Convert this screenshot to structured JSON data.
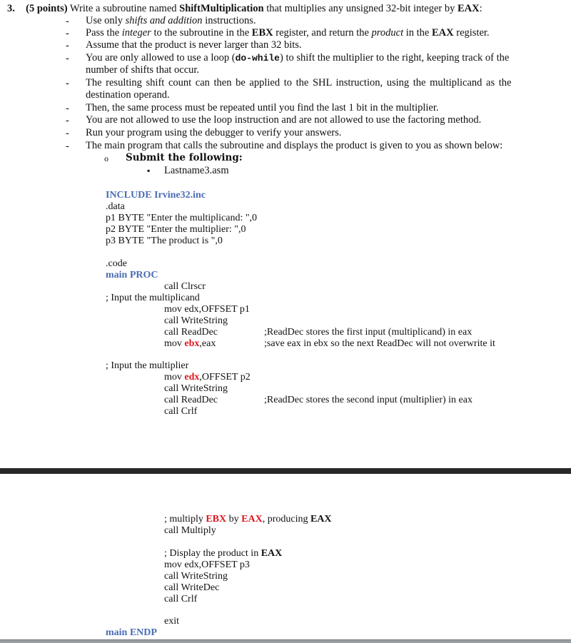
{
  "question": {
    "number": "3.",
    "points": "(5 points)",
    "intro_pre": " Write a subroutine named ",
    "subroutine_name": "ShiftMultiplication",
    "intro_post": " that multiplies any unsigned 32-bit integer by ",
    "intro_reg": "EAX",
    "intro_end": ":"
  },
  "bullets": [
    {
      "parts": [
        "Use only ",
        "shifts and addition",
        " instructions."
      ]
    },
    {
      "parts": [
        "Pass the ",
        "integer",
        " to the subroutine in the ",
        "EBX",
        " register, and return the ",
        "product",
        " in the ",
        "EAX",
        " register."
      ]
    },
    {
      "parts": [
        "Assume that the product is never larger than 32 bits."
      ]
    },
    {
      "parts": [
        "You are only allowed to use a loop (",
        "do-while",
        ") to shift the multiplier to the right, keeping track of the",
        "number of shifts that occur."
      ]
    },
    {
      "parts": [
        "The resulting shift count can then be applied to the SHL instruction, using the multiplicand as the",
        "destination operand."
      ]
    },
    {
      "parts": [
        "Then, the same process must be repeated until you find the last 1 bit in the multiplier."
      ]
    },
    {
      "parts": [
        "You are not allowed to use the loop instruction and are not allowed to use the factoring method."
      ]
    },
    {
      "parts": [
        "Run your program using the debugger to verify your answers."
      ]
    },
    {
      "parts": [
        "The main program that calls the subroutine and displays the product is given to you as shown below:"
      ]
    }
  ],
  "bullet_marker": "-",
  "submit": {
    "marker": "o",
    "label": "Submit the following:",
    "file_marker": "▪",
    "file": "Lastname3.asm"
  },
  "code": {
    "include": "INCLUDE Irvine32.inc",
    "data_section": ".data",
    "p1": "p1 BYTE \"Enter the multiplicand: \",0",
    "p2": "p2 BYTE \"Enter the multiplier: \",0",
    "p3": "p3 BYTE \"The product is \",0",
    "code_section": ".code",
    "main_proc": "main PROC",
    "clrscr": "call Clrscr",
    "comment_input_multiplicand": "; Input the multiplicand",
    "mov_edx_p1": "mov edx,OFFSET p1",
    "write_string_1": "call WriteString",
    "read_dec_1": "call  ReadDec",
    "read_dec_1_comment": ";ReadDec stores the first input (multiplicand) in eax",
    "mov_ebx_pre": "mov ",
    "mov_ebx_reg": "ebx",
    "mov_ebx_post": ",eax",
    "mov_ebx_comment": ";save eax in ebx so the next ReadDec will not overwrite it",
    "comment_input_multiplier": "; Input the multiplier",
    "mov_edx_p2_pre": "mov ",
    "mov_edx_p2_reg": "edx",
    "mov_edx_p2_post": ",OFFSET p2",
    "write_string_2": "call  WriteString",
    "read_dec_2": "call ReadDec",
    "read_dec_2_comment": ";ReadDec stores the second input (multiplier) in eax",
    "crlf_1": "call Crlf",
    "comment_multiply_pre": "; multiply ",
    "comment_multiply_ebx": "EBX",
    "comment_multiply_by": " by ",
    "comment_multiply_eax": "EAX",
    "comment_multiply_producing": ", producing ",
    "comment_multiply_result": "EAX",
    "call_multiply": "call Multiply",
    "comment_display_pre": "; Display the product in ",
    "comment_display_reg": "EAX",
    "mov_edx_p3": "mov edx,OFFSET p3",
    "write_string_3": "call  WriteString",
    "write_dec": "call WriteDec",
    "crlf_2": "call Crlf",
    "exit": "exit",
    "main_endp": "main ENDP"
  }
}
